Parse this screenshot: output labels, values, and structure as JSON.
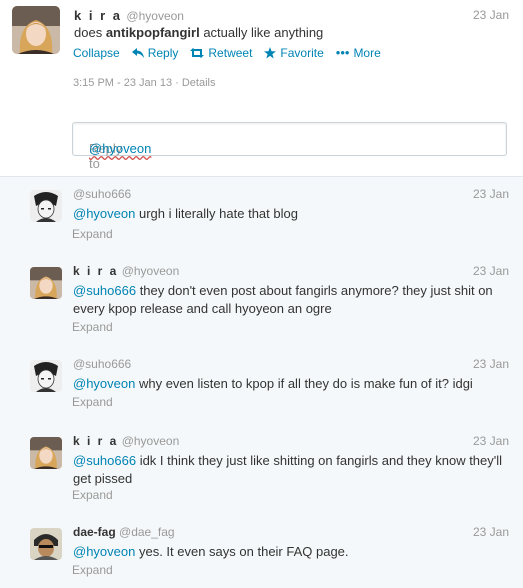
{
  "main_tweet": {
    "name": "k i r a",
    "handle": "@hyoveon",
    "date": "23 Jan",
    "text_prefix": "does ",
    "text_bold": "antikpopfangirl",
    "text_suffix": " actually like anything",
    "actions": {
      "collapse": "Collapse",
      "reply": "Reply",
      "retweet": "Retweet",
      "favorite": "Favorite",
      "more": "More"
    },
    "timestamp": "3:15 PM - 23 Jan 13",
    "details": "Details"
  },
  "reply_box": {
    "placeholder_prefix": "Reply to ",
    "placeholder_handle": "@hyoveon"
  },
  "replies": [
    {
      "name": "",
      "handle": "@suho666",
      "date": "23 Jan",
      "mention": "@hyoveon",
      "text": " urgh i literally hate that blog",
      "expand": "Expand"
    },
    {
      "name": "k i r a",
      "handle": "@hyoveon",
      "date": "23 Jan",
      "mention": "@suho666",
      "text": " they don't even post about fangirls anymore? they just shit on every kpop release and call hyoyeon an ogre",
      "expand": "Expand"
    },
    {
      "name": "",
      "handle": "@suho666",
      "date": "23 Jan",
      "mention": "@hyoveon",
      "text": " why even listen to kpop if all they do is make fun of it? idgi",
      "expand": "Expand"
    },
    {
      "name": "k i r a",
      "handle": "@hyoveon",
      "date": "23 Jan",
      "mention": "@suho666",
      "text": " idk I think they just like shitting on fangirls and they know they'll get pissed",
      "expand": "Expand"
    },
    {
      "name": "dae-fag",
      "handle": "@dae_fag",
      "date": "23 Jan",
      "mention": "@hyoveon",
      "text": " yes. It even says on their FAQ page.",
      "expand": "Expand"
    }
  ],
  "colors": {
    "link": "#0084b4",
    "muted": "#999999",
    "reply_bg": "#f5f8fa"
  }
}
